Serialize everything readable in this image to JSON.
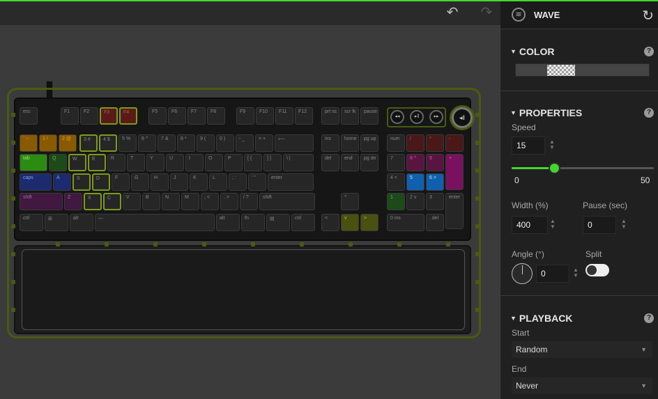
{
  "panel": {
    "title": "WAVE",
    "sections": {
      "color": "COLOR",
      "properties": "PROPERTIES",
      "playback": "PLAYBACK"
    },
    "help_glyph": "?",
    "properties": {
      "speed_label": "Speed",
      "speed_value": "15",
      "speed_min": "0",
      "speed_max": "50",
      "speed_fraction": 0.3,
      "width_label": "Width (%)",
      "width_value": "400",
      "pause_label": "Pause (sec)",
      "pause_value": "0",
      "angle_label": "Angle (°)",
      "angle_value": "0",
      "split_label": "Split",
      "split_on": false
    },
    "playback": {
      "start_label": "Start",
      "start_value": "Random",
      "end_label": "End",
      "end_value": "Never"
    }
  },
  "icons": {
    "undo": "undo-icon",
    "redo": "redo-icon",
    "reset": "reset-icon",
    "effect": "wave-effect-icon"
  },
  "colors": {
    "accent": "#44d62c",
    "highlight_outline": "#7d9b1a"
  },
  "keyboard": {
    "rows": [
      [
        {
          "l": "esc"
        },
        {
          "l": "F1"
        },
        {
          "l": "F2"
        },
        {
          "l": "F3",
          "c": "red",
          "h": true
        },
        {
          "l": "F4",
          "c": "red",
          "h": true
        },
        {
          "l": "F5"
        },
        {
          "l": "F6"
        },
        {
          "l": "F7"
        },
        {
          "l": "F8"
        },
        {
          "l": "F9"
        },
        {
          "l": "F10"
        },
        {
          "l": "F11"
        },
        {
          "l": "F12"
        },
        {
          "l": "prt sc"
        },
        {
          "l": "scr lk"
        },
        {
          "l": "pause"
        }
      ],
      [
        {
          "l": "` ~",
          "c": "orange"
        },
        {
          "l": "1 !",
          "c": "orange"
        },
        {
          "l": "2 @",
          "c": "orange"
        },
        {
          "l": "3 #",
          "h": true
        },
        {
          "l": "4 $",
          "h": true
        },
        {
          "l": "5 %"
        },
        {
          "l": "6 ^"
        },
        {
          "l": "7 &"
        },
        {
          "l": "8 *"
        },
        {
          "l": "9 ("
        },
        {
          "l": "0 )"
        },
        {
          "l": "- _"
        },
        {
          "l": "= +"
        },
        {
          "l": "⟵"
        },
        {
          "l": "ins"
        },
        {
          "l": "home"
        },
        {
          "l": "pg up"
        },
        {
          "l": "num"
        },
        {
          "l": "/",
          "c": "dred"
        },
        {
          "l": "*",
          "c": "dred"
        },
        {
          "l": "-",
          "c": "dred"
        }
      ],
      [
        {
          "l": "tab",
          "c": "green"
        },
        {
          "l": "Q",
          "c": "dgreen"
        },
        {
          "l": "W",
          "h": true
        },
        {
          "l": "E",
          "h": true
        },
        {
          "l": "R"
        },
        {
          "l": "T"
        },
        {
          "l": "Y"
        },
        {
          "l": "U"
        },
        {
          "l": "I"
        },
        {
          "l": "O"
        },
        {
          "l": "P"
        },
        {
          "l": "[ {"
        },
        {
          "l": "] }"
        },
        {
          "l": "\\ |"
        },
        {
          "l": "del"
        },
        {
          "l": "end"
        },
        {
          "l": "pg dn"
        },
        {
          "l": "7"
        },
        {
          "l": "8 ^",
          "c": "magenta"
        },
        {
          "l": "9",
          "c": "magenta"
        },
        {
          "l": "+",
          "c": "mag2"
        }
      ],
      [
        {
          "l": "caps",
          "c": "blue"
        },
        {
          "l": "A",
          "c": "blue"
        },
        {
          "l": "S",
          "h": true
        },
        {
          "l": "D",
          "h": true
        },
        {
          "l": "F"
        },
        {
          "l": "G"
        },
        {
          "l": "H"
        },
        {
          "l": "J"
        },
        {
          "l": "K"
        },
        {
          "l": "L"
        },
        {
          "l": "; :"
        },
        {
          "l": "' \""
        },
        {
          "l": "enter"
        },
        {
          "l": "4 <"
        },
        {
          "l": "5",
          "c": "bright-blue"
        },
        {
          "l": "6 >",
          "c": "bright-blue"
        }
      ],
      [
        {
          "l": "shift",
          "c": "purple"
        },
        {
          "l": "Z",
          "c": "purple"
        },
        {
          "l": "X",
          "h": true
        },
        {
          "l": "C",
          "h": true
        },
        {
          "l": "V"
        },
        {
          "l": "B"
        },
        {
          "l": "N"
        },
        {
          "l": "M"
        },
        {
          "l": ", <"
        },
        {
          "l": ". >"
        },
        {
          "l": "/ ?"
        },
        {
          "l": "shift"
        },
        {
          "l": "^"
        },
        {
          "l": "1",
          "c": "dgreen"
        },
        {
          "l": "2 v"
        },
        {
          "l": "3"
        },
        {
          "l": "enter"
        }
      ],
      [
        {
          "l": "ctrl"
        },
        {
          "l": "⊞"
        },
        {
          "l": "alt"
        },
        {
          "l": "—"
        },
        {
          "l": "alt"
        },
        {
          "l": "fn"
        },
        {
          "l": "▤"
        },
        {
          "l": "ctrl"
        },
        {
          "l": "<"
        },
        {
          "l": "v",
          "c": "olive"
        },
        {
          "l": ">",
          "c": "olive"
        },
        {
          "l": "0 ins"
        },
        {
          "l": ". del"
        }
      ]
    ],
    "media": [
      "◂◂",
      "▸‖",
      "▸▸"
    ],
    "dial": "◂‖"
  }
}
